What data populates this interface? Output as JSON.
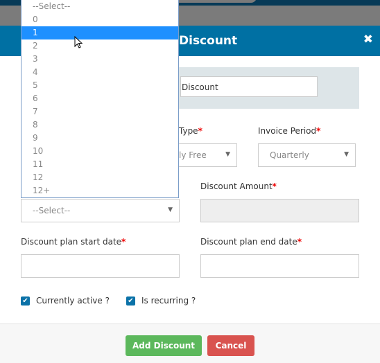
{
  "modal": {
    "title": "Discount",
    "close_icon": "close-icon"
  },
  "name_panel": {
    "value": "Discount"
  },
  "type_field": {
    "label": "Type",
    "value": "ly Free"
  },
  "invoice_period": {
    "label": "Invoice Period",
    "value": "Quarterly"
  },
  "months_select": {
    "value": "--Select--",
    "options": [
      "--Select--",
      "0",
      "1",
      "2",
      "3",
      "4",
      "5",
      "6",
      "7",
      "8",
      "9",
      "10",
      "11",
      "12",
      "12+"
    ],
    "highlighted": "1"
  },
  "discount_amount": {
    "label": "Discount Amount",
    "value": ""
  },
  "start_date": {
    "label": "Discount plan start date",
    "value": ""
  },
  "end_date": {
    "label": "Discount plan end date",
    "value": ""
  },
  "required_marker": "*",
  "checkboxes": [
    {
      "label": "Currently active ?",
      "checked": true
    },
    {
      "label": "Is recurring ?",
      "checked": true
    }
  ],
  "buttons": {
    "add": "Add Discount",
    "cancel": "Cancel"
  },
  "colors": {
    "header": "#0070a3",
    "highlight": "#1e90ff",
    "add": "#5cb85c",
    "cancel": "#d9534f"
  }
}
